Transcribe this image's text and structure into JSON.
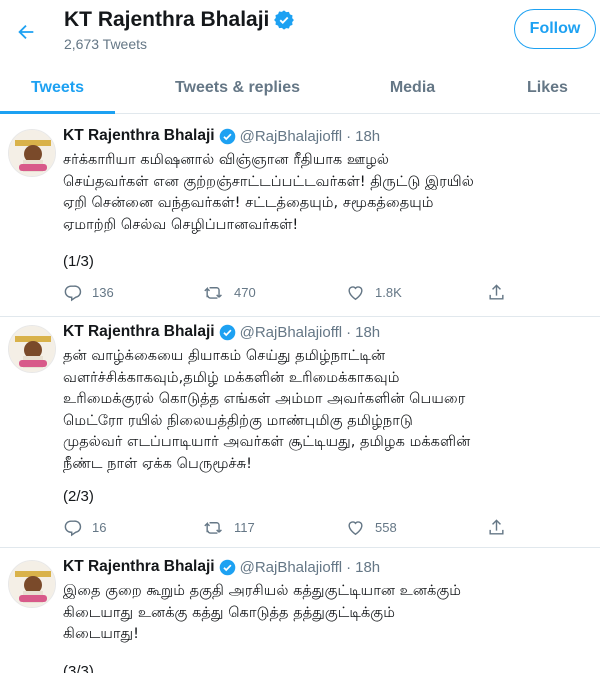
{
  "colors": {
    "accent": "#1da1f2",
    "text": "#14171a",
    "muted": "#657786",
    "divider": "#e1e8ed"
  },
  "header": {
    "back_icon": "arrow-left-icon",
    "name": "KT Rajenthra Bhalaji",
    "verified_icon": "verified-badge-icon",
    "tweet_count": "2,673 Tweets",
    "follow_label": "Follow"
  },
  "tabs": [
    {
      "label": "Tweets",
      "active": true
    },
    {
      "label": "Tweets & replies",
      "active": false
    },
    {
      "label": "Media",
      "active": false
    },
    {
      "label": "Likes",
      "active": false
    }
  ],
  "tweets": [
    {
      "name": "KT Rajenthra Bhalaji",
      "handle": "@RajBhalajioffl",
      "time": "18h",
      "text": "சர்க்காரியா கமிஷனால் விஞ்ஞான ரீதியாக ஊழல்\nசெய்தவர்கள் என  குற்றஞ்சாட்டப்பட்டவர்கள்! திருட்டு இரயில்\nஏறி சென்னை வந்தவர்கள்! சட்டத்தையும், சமூகத்தையும்\nஏமாற்றி செல்வ செழிப்பானவர்கள்!",
      "count": "(1/3)",
      "replies": "136",
      "retweets": "470",
      "likes": "1.8K"
    },
    {
      "name": "KT Rajenthra Bhalaji",
      "handle": "@RajBhalajioffl",
      "time": "18h",
      "text": "தன் வாழ்க்கையை தியாகம் செய்து தமிழ்நாட்டின்\nவளர்ச்சிக்காகவும்,தமிழ் மக்களின் உரிமைக்காகவும்\nஉரிமைக்குரல் கொடுத்த எங்கள் அம்மா அவர்களின் பெயரை\nமெட்ரோ ரயில் நிலையத்திற்கு மாண்புமிகு தமிழ்நாடு\nமுதல்வர் எடப்பாடியார் அவர்கள் சூட்டியது, தமிழக மக்களின்\nநீண்ட நாள் ஏக்க பெருமூச்சு!",
      "count": "(2/3)",
      "replies": "16",
      "retweets": "117",
      "likes": "558"
    },
    {
      "name": "KT Rajenthra Bhalaji",
      "handle": "@RajBhalajioffl",
      "time": "18h",
      "text": "இதை குறை கூறும் தகுதி அரசியல் கத்துகுட்டியான உனக்கும்\nகிடையாது உனக்கு கத்து கொடுத்த தத்துகுட்டிக்கும்\nகிடையாது!",
      "count": "(3/3)"
    }
  ],
  "icons": {
    "reply": "reply-icon",
    "retweet": "retweet-icon",
    "like": "heart-icon",
    "share": "share-icon"
  }
}
